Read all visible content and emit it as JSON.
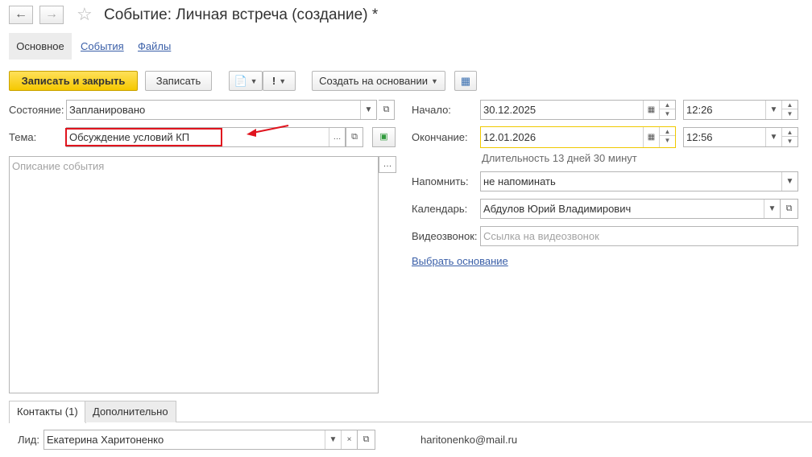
{
  "window": {
    "title": "Событие: Личная встреча (создание) *"
  },
  "tabs": [
    {
      "label": "Основное",
      "active": true
    },
    {
      "label": "События",
      "active": false
    },
    {
      "label": "Файлы",
      "active": false
    }
  ],
  "toolbar": {
    "save_close": "Записать и закрыть",
    "save": "Записать",
    "importance": "!",
    "create_based": "Создать на основании"
  },
  "left": {
    "state_label": "Состояние:",
    "state_value": "Запланировано",
    "topic_label": "Тема:",
    "topic_value": "Обсуждение условий КП",
    "description_placeholder": "Описание события"
  },
  "right": {
    "start_label": "Начало:",
    "start_date": "30.12.2025",
    "start_time": "12:26",
    "end_label": "Окончание:",
    "end_date": "12.01.2026",
    "end_time": "12:56",
    "duration": "Длительность 13 дней 30 минут",
    "remind_label": "Напомнить:",
    "remind_value": "не напоминать",
    "calendar_label": "Календарь:",
    "calendar_value": "Абдулов Юрий Владимирович",
    "video_label": "Видеозвонок:",
    "video_placeholder": "Ссылка на видеозвонок",
    "choose_basis": "Выбрать основание"
  },
  "bottom_tabs": [
    {
      "label": "Контакты (1)",
      "active": true
    },
    {
      "label": "Дополнительно",
      "active": false
    }
  ],
  "contact": {
    "label": "Лид:",
    "value": "Екатерина Харитоненко",
    "email": "haritonenko@mail.ru"
  },
  "colors": {
    "accent_yellow": "#f5c800",
    "link_blue": "#3a5fa8",
    "highlight_red": "#e0141e"
  }
}
